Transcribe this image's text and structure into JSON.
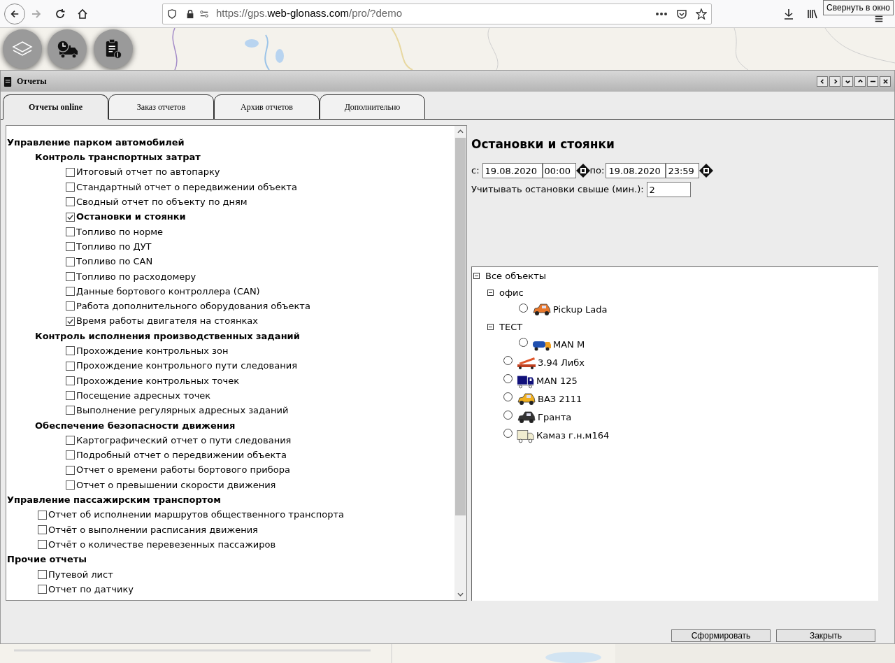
{
  "browser": {
    "url_host": "https://gps.",
    "url_domain": "web-glonass.com",
    "url_path": "/pro/?demo",
    "tooltip": "Свернуть в окно"
  },
  "window": {
    "title": "Отчеты"
  },
  "tabs": [
    {
      "label": "Отчеты online",
      "selected": true
    },
    {
      "label": "Заказ отчетов",
      "selected": false
    },
    {
      "label": "Архив отчетов",
      "selected": false
    },
    {
      "label": "Дополнительно",
      "selected": false
    }
  ],
  "reports": [
    {
      "kind": "category",
      "label": "Управление парком автомобилей",
      "children": [
        {
          "kind": "category",
          "label": "Контроль транспортных затрат",
          "children": [
            {
              "kind": "report",
              "label": "Итоговый отчет по автопарку",
              "checked": false,
              "selected": false
            },
            {
              "kind": "report",
              "label": "Стандартный отчет о передвижении объекта",
              "checked": false,
              "selected": false
            },
            {
              "kind": "report",
              "label": "Сводный отчет по объекту по дням",
              "checked": false,
              "selected": false
            },
            {
              "kind": "report",
              "label": "Остановки и стоянки",
              "checked": true,
              "selected": true
            },
            {
              "kind": "report",
              "label": "Топливо по норме",
              "checked": false,
              "selected": false
            },
            {
              "kind": "report",
              "label": "Топливо по ДУТ",
              "checked": false,
              "selected": false
            },
            {
              "kind": "report",
              "label": "Топливо по CAN",
              "checked": false,
              "selected": false
            },
            {
              "kind": "report",
              "label": "Топливо по расходомеру",
              "checked": false,
              "selected": false
            },
            {
              "kind": "report",
              "label": "Данные бортового контроллера (CAN)",
              "checked": false,
              "selected": false
            },
            {
              "kind": "report",
              "label": "Работа дополнительного оборудования объекта",
              "checked": false,
              "selected": false
            },
            {
              "kind": "report",
              "label": "Время работы двигателя на стоянках",
              "checked": true,
              "selected": false
            }
          ]
        },
        {
          "kind": "category",
          "label": "Контроль исполнения производственных заданий",
          "children": [
            {
              "kind": "report",
              "label": "Прохождение контрольных зон",
              "checked": false,
              "selected": false
            },
            {
              "kind": "report",
              "label": "Прохождение контрольного пути следования",
              "checked": false,
              "selected": false
            },
            {
              "kind": "report",
              "label": "Прохождение контрольных точек",
              "checked": false,
              "selected": false
            },
            {
              "kind": "report",
              "label": "Посещение адресных точек",
              "checked": false,
              "selected": false
            },
            {
              "kind": "report",
              "label": "Выполнение регулярных адресных заданий",
              "checked": false,
              "selected": false
            }
          ]
        },
        {
          "kind": "category",
          "label": "Обеспечение безопасности движения",
          "children": [
            {
              "kind": "report",
              "label": "Картографический отчет о пути следования",
              "checked": false,
              "selected": false
            },
            {
              "kind": "report",
              "label": "Подробный отчет о передвижении объекта",
              "checked": false,
              "selected": false
            },
            {
              "kind": "report",
              "label": "Отчет о времени работы бортового прибора",
              "checked": false,
              "selected": false
            },
            {
              "kind": "report",
              "label": "Отчет о превышении скорости движения",
              "checked": false,
              "selected": false
            }
          ]
        }
      ]
    },
    {
      "kind": "category",
      "label": "Управление пассажирским транспортом",
      "children": [
        {
          "kind": "report",
          "label": "Отчет об исполнении маршрутов общественного транспорта",
          "checked": false,
          "selected": false
        },
        {
          "kind": "report",
          "label": "Отчёт о выполнении расписания движения",
          "checked": false,
          "selected": false
        },
        {
          "kind": "report",
          "label": "Отчёт о количестве перевезенных пассажиров",
          "checked": false,
          "selected": false
        }
      ]
    },
    {
      "kind": "category",
      "label": "Прочие отчеты",
      "children": [
        {
          "kind": "report",
          "label": "Путевой лист",
          "checked": false,
          "selected": false
        },
        {
          "kind": "report",
          "label": "Отчет по датчику",
          "checked": false,
          "selected": false
        }
      ]
    }
  ],
  "form": {
    "title": "Остановки и стоянки",
    "from_label": "с:",
    "from_date": "19.08.2020",
    "from_time": "00:00",
    "to_label": "по:",
    "to_date": "19.08.2020",
    "to_time": "23:59",
    "min_stop_label": "Учитывать остановки свыше (мин.):",
    "min_stop_value": "2"
  },
  "objects": [
    {
      "kind": "group",
      "label": "Все объекты",
      "expanded": true,
      "children": [
        {
          "kind": "group",
          "label": "офис",
          "expanded": true,
          "children": [
            {
              "kind": "car",
              "label": "Pickup Lada",
              "color": "#e8772a",
              "selected": false
            }
          ]
        },
        {
          "kind": "group",
          "label": "ТЕСТ",
          "expanded": true,
          "children": [
            {
              "kind": "tanker",
              "label": "MAN M",
              "color": "#f0a020",
              "selected": false
            }
          ]
        },
        {
          "kind": "crane",
          "label": "3.94 Либх",
          "color": "#e0562a",
          "selected": false
        },
        {
          "kind": "lorry",
          "label": "MAN 125",
          "color": "#10107a",
          "selected": false
        },
        {
          "kind": "car",
          "label": "ВАЗ 2111",
          "color": "#f0b020",
          "selected": false
        },
        {
          "kind": "car",
          "label": "Гранта",
          "color": "#333333",
          "selected": false
        },
        {
          "kind": "van",
          "label": "Камаз г.н.м164",
          "color": "#f0ecd0",
          "selected": false
        }
      ]
    }
  ],
  "buttons": [
    "Сформировать",
    "Закрыть"
  ]
}
